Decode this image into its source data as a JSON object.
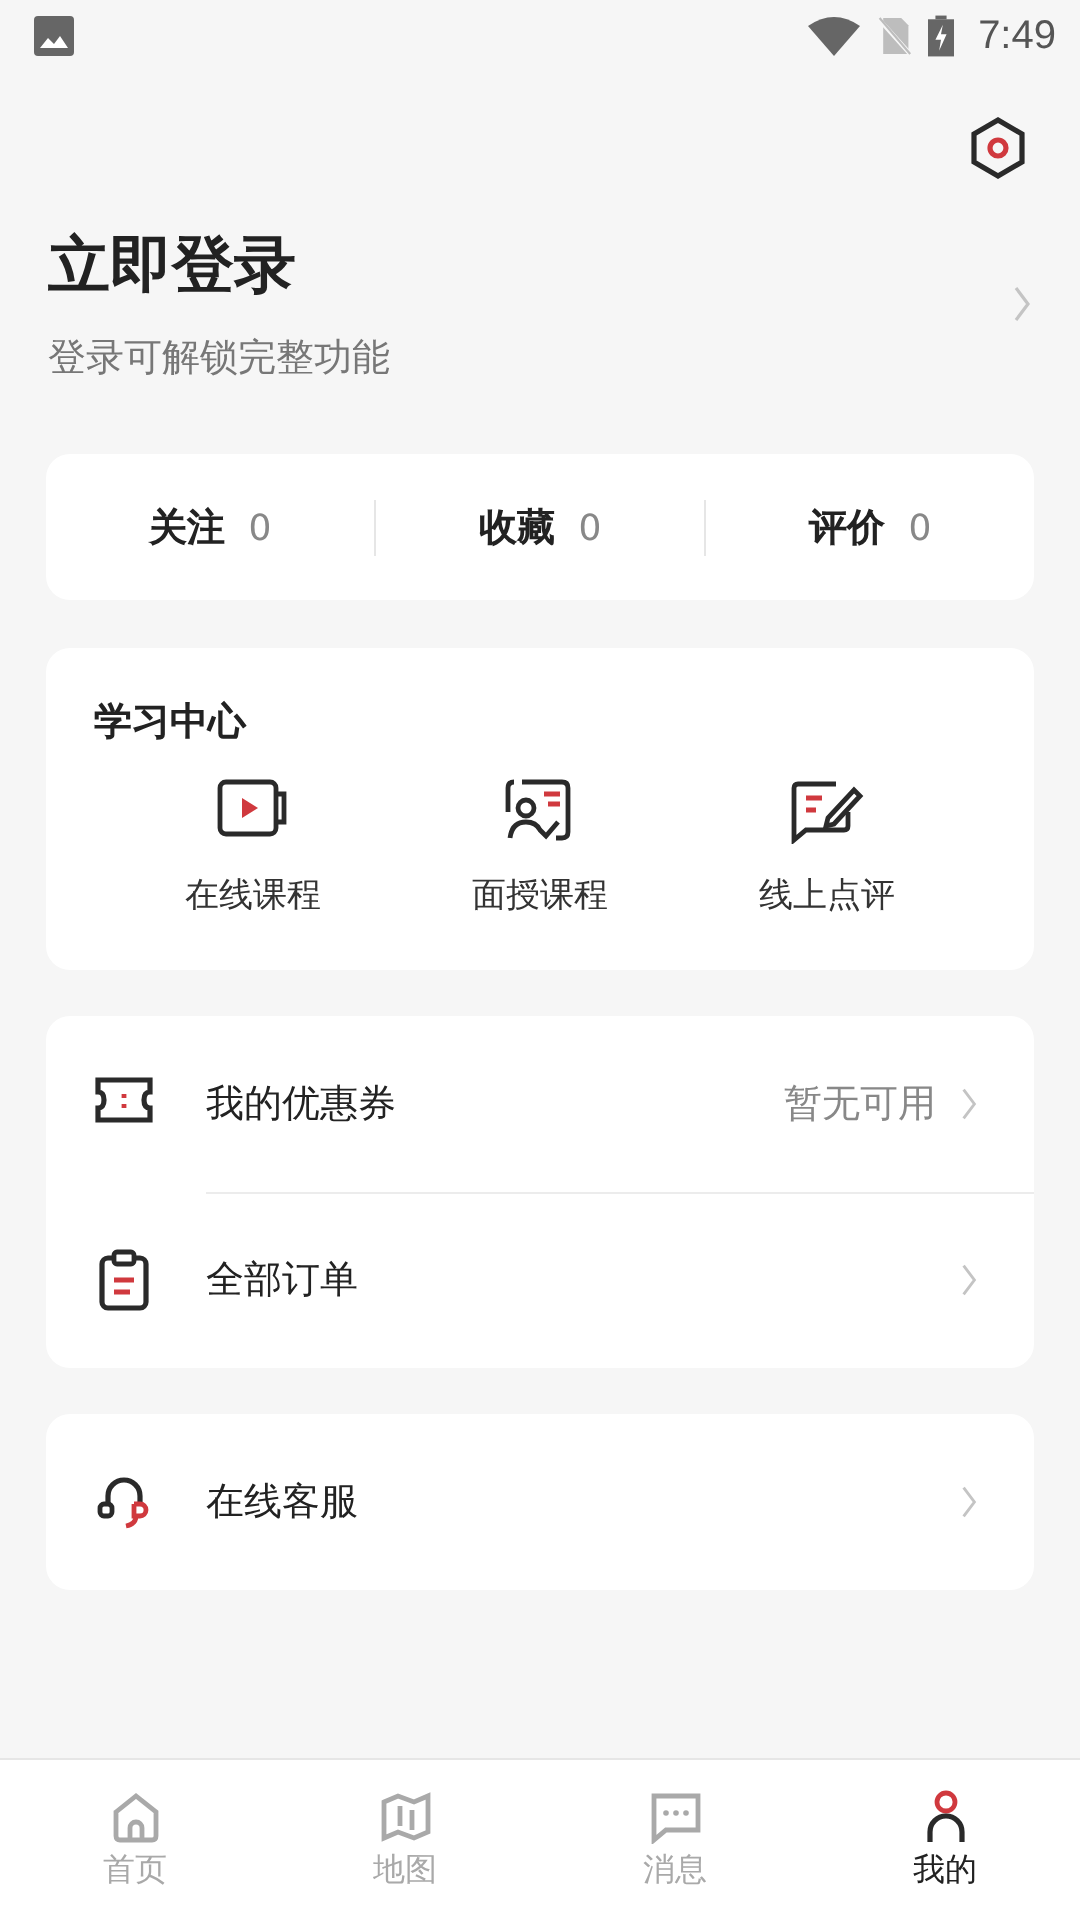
{
  "status_bar": {
    "time": "7:49"
  },
  "login": {
    "title": "立即登录",
    "subtitle": "登录可解锁完整功能"
  },
  "stats": [
    {
      "label": "关注",
      "count": "0"
    },
    {
      "label": "收藏",
      "count": "0"
    },
    {
      "label": "评价",
      "count": "0"
    }
  ],
  "learning_center": {
    "title": "学习中心",
    "items": [
      {
        "kind": "video",
        "label": "在线课程"
      },
      {
        "kind": "teacher",
        "label": "面授课程"
      },
      {
        "kind": "review",
        "label": "线上点评"
      }
    ]
  },
  "menu": [
    {
      "kind": "coupon",
      "label": "我的优惠券",
      "value": "暂无可用"
    },
    {
      "kind": "orders",
      "label": "全部订单"
    }
  ],
  "service": [
    {
      "kind": "headset",
      "label": "在线客服"
    }
  ],
  "tab_bar": [
    {
      "kind": "home",
      "label": "首页",
      "selected": false
    },
    {
      "kind": "map",
      "label": "地图",
      "selected": false
    },
    {
      "kind": "message",
      "label": "消息",
      "selected": false
    },
    {
      "kind": "profile",
      "label": "我的",
      "selected": true
    }
  ]
}
